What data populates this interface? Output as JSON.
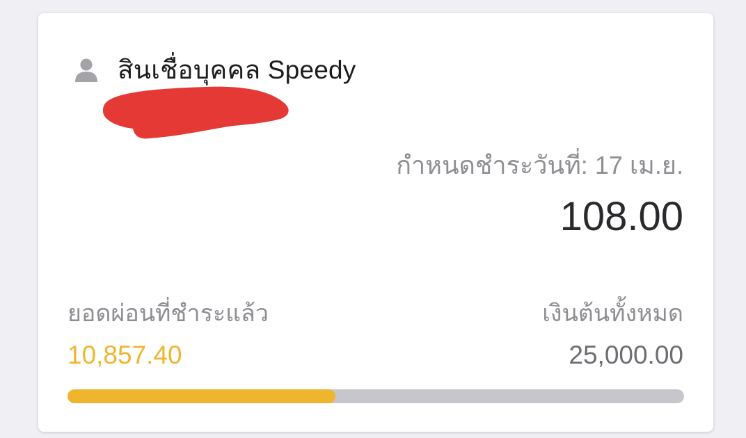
{
  "loan": {
    "title": "สินเชื่อบุคคล Speedy",
    "icon": "user-icon",
    "due_label": "กำหนดชำระวันที่: 17 เม.ย.",
    "due_amount": "108.00",
    "paid_label": "ยอดผ่อนที่ชำระแล้ว",
    "paid_value": "10,857.40",
    "total_label": "เงินต้นทั้งหมด",
    "total_value": "25,000.00",
    "progress_fraction": 0.4343
  },
  "colors": {
    "accent": "#efb52e",
    "track": "#c7c6cb",
    "redaction": "#e53935"
  }
}
